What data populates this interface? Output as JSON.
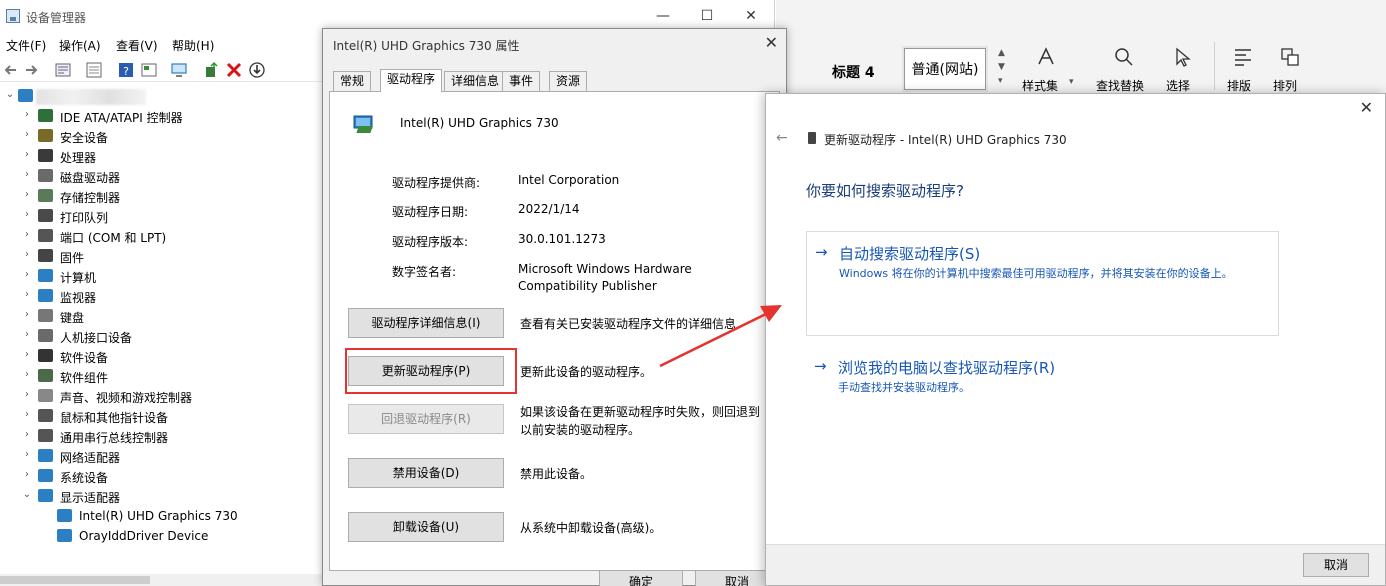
{
  "device_manager": {
    "title": "设备管理器",
    "window_controls": {
      "minimize": "—",
      "maximize": "☐",
      "close": "✕"
    },
    "menu": [
      "文件(F)",
      "操作(A)",
      "查看(V)",
      "帮助(H)"
    ],
    "tree": [
      {
        "label": "IDE ATA/ATAPI 控制器",
        "icon_color": "#2f6f3a",
        "expanded": false
      },
      {
        "label": "安全设备",
        "icon_color": "#7a6a2a",
        "expanded": false
      },
      {
        "label": "处理器",
        "icon_color": "#3a3a3a",
        "expanded": false
      },
      {
        "label": "磁盘驱动器",
        "icon_color": "#6a6a6a",
        "expanded": false
      },
      {
        "label": "存储控制器",
        "icon_color": "#5a7a5a",
        "expanded": false
      },
      {
        "label": "打印队列",
        "icon_color": "#4a4a4a",
        "expanded": false
      },
      {
        "label": "端口 (COM 和 LPT)",
        "icon_color": "#555555",
        "expanded": false
      },
      {
        "label": "固件",
        "icon_color": "#444444",
        "expanded": false
      },
      {
        "label": "计算机",
        "icon_color": "#2d7fc4",
        "expanded": false
      },
      {
        "label": "监视器",
        "icon_color": "#2d7fc4",
        "expanded": false
      },
      {
        "label": "键盘",
        "icon_color": "#777777",
        "expanded": false
      },
      {
        "label": "人机接口设备",
        "icon_color": "#6a6a6a",
        "expanded": false
      },
      {
        "label": "软件设备",
        "icon_color": "#333333",
        "expanded": false
      },
      {
        "label": "软件组件",
        "icon_color": "#4a6a4a",
        "expanded": false
      },
      {
        "label": "声音、视频和游戏控制器",
        "icon_color": "#888888",
        "expanded": false
      },
      {
        "label": "鼠标和其他指针设备",
        "icon_color": "#555555",
        "expanded": false
      },
      {
        "label": "通用串行总线控制器",
        "icon_color": "#555555",
        "expanded": false
      },
      {
        "label": "网络适配器",
        "icon_color": "#2d7fc4",
        "expanded": false
      },
      {
        "label": "系统设备",
        "icon_color": "#2d7fc4",
        "expanded": false
      },
      {
        "label": "显示适配器",
        "icon_color": "#2d7fc4",
        "expanded": true
      }
    ],
    "children": [
      "Intel(R) UHD Graphics 730",
      "OrayIddDriver Device"
    ]
  },
  "word": {
    "heading_style": "标题 4",
    "style_box": "普通(网站)",
    "groups": [
      "样式集",
      "查找替换",
      "选择",
      "排版",
      "排列"
    ]
  },
  "properties": {
    "title": "Intel(R) UHD Graphics 730 属性",
    "tabs": [
      "常规",
      "驱动程序",
      "详细信息",
      "事件",
      "资源"
    ],
    "active_tab": "驱动程序",
    "device_name": "Intel(R) UHD Graphics 730",
    "info": [
      {
        "key": "驱动程序提供商:",
        "value": "Intel Corporation"
      },
      {
        "key": "驱动程序日期:",
        "value": "2022/1/14"
      },
      {
        "key": "驱动程序版本:",
        "value": "30.0.101.1273"
      },
      {
        "key": "数字签名者:",
        "value": "Microsoft Windows Hardware\nCompatibility Publisher"
      }
    ],
    "buttons": [
      {
        "label": "驱动程序详细信息(I)",
        "desc": "查看有关已安装驱动程序文件的详细信息",
        "disabled": false
      },
      {
        "label": "更新驱动程序(P)",
        "desc": "更新此设备的驱动程序。",
        "disabled": false
      },
      {
        "label": "回退驱动程序(R)",
        "desc": "如果该设备在更新驱动程序时失败，则回退到以前安装的驱动程序。",
        "disabled": true
      },
      {
        "label": "禁用设备(D)",
        "desc": "禁用此设备。",
        "disabled": false
      },
      {
        "label": "卸载设备(U)",
        "desc": "从系统中卸载设备(高级)。",
        "disabled": false
      }
    ],
    "ok": "确定",
    "cancel": "取消",
    "highlight_color": "#e3342f"
  },
  "update_driver": {
    "title": "更新驱动程序 - Intel(R) UHD Graphics 730",
    "heading": "你要如何搜索驱动程序?",
    "option1": {
      "title": "自动搜索驱动程序(S)",
      "desc": "Windows 将在你的计算机中搜索最佳可用驱动程序，并将其安装在你的设备上。"
    },
    "option2": {
      "title": "浏览我的电脑以查找驱动程序(R)",
      "desc": "手动查找并安装驱动程序。"
    },
    "cancel": "取消",
    "accent": "#1657b5"
  }
}
